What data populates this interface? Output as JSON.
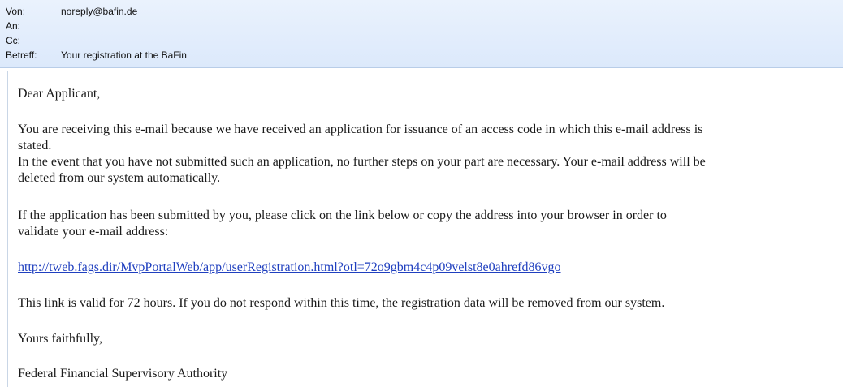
{
  "header": {
    "from_label": "Von:",
    "from_value": "noreply@bafin.de",
    "to_label": "An:",
    "to_value": "",
    "cc_label": "Cc:",
    "cc_value": "",
    "subject_label": "Betreff:",
    "subject_value": "Your registration at the BaFin"
  },
  "body": {
    "greeting": "Dear Applicant,",
    "para1_line1": "You are receiving this e-mail because we have received an application for issuance of an access code in which this e-mail address is",
    "para1_line2": "stated.",
    "para1_line3": "In the event that you have not submitted such an application, no further steps on your part are necessary. Your e-mail address will be",
    "para1_line4": "deleted from our system automatically.",
    "para2_line1": "If the application has been submitted by you, please click on the link below or copy the address into your browser in order to",
    "para2_line2": "validate your e-mail address:",
    "link": "http://tweb.fags.dir/MvpPortalWeb/app/userRegistration.html?otl=72o9gbm4c4p09velst8e0ahrefd86vgo",
    "validity": "This link is valid for 72 hours. If you do not respond within this time, the registration data will be removed from our system.",
    "closing": "Yours faithfully,",
    "signature": "Federal Financial Supervisory Authority"
  },
  "colors": {
    "header_background": "#dce9fb",
    "link": "#1f3fbf",
    "body_text": "#1a1a1a"
  }
}
